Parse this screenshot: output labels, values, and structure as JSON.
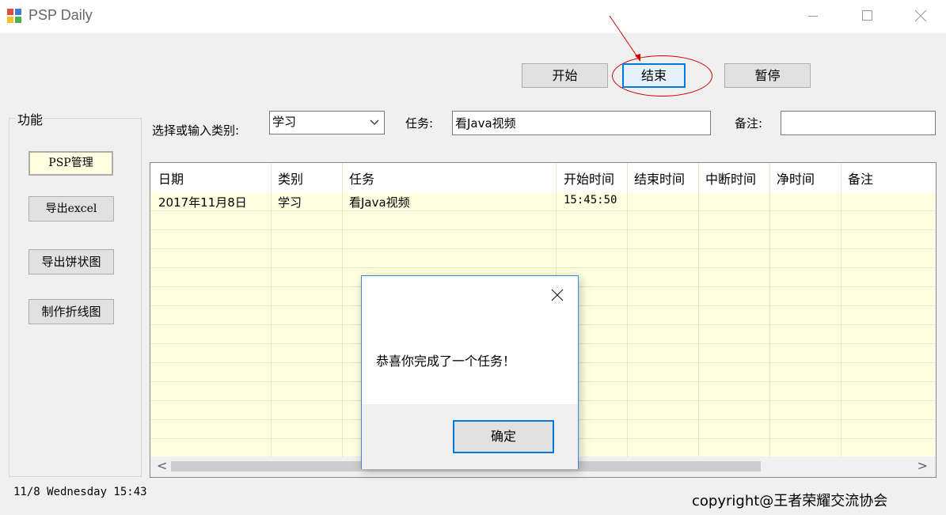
{
  "window": {
    "title": "PSP Daily",
    "icon": "app-icon",
    "controls": [
      "minimize-icon",
      "maximize-icon",
      "close-icon"
    ]
  },
  "toolbar": {
    "start_label": "开始",
    "end_label": "结束",
    "pause_label": "暂停"
  },
  "sidebar": {
    "group_title": "功能",
    "items": [
      {
        "label": "PSP管理"
      },
      {
        "label": "导出excel"
      },
      {
        "label": "导出饼状图"
      },
      {
        "label": "制作折线图"
      }
    ]
  },
  "form": {
    "category_label": "选择或输入类别:",
    "category_value": "学习",
    "task_label": "任务:",
    "task_value": "看Java视频",
    "note_label": "备注:",
    "note_value": ""
  },
  "grid": {
    "columns": [
      "日期",
      "类别",
      "任务",
      "开始时间",
      "结束时间",
      "中断时间",
      "净时间",
      "备注"
    ],
    "rows": [
      [
        "2017年11月8日",
        "学习",
        "看Java视频",
        "15:45:50",
        "",
        "",
        "",
        ""
      ]
    ],
    "scroll_left": "<",
    "scroll_right": ">"
  },
  "dialog": {
    "message": "恭喜你完成了一个任务！",
    "ok_label": "确定"
  },
  "status": {
    "datetime": "11/8  Wednesday 15:43"
  },
  "footer": {
    "copyright": "copyright@王者荣耀交流协会"
  },
  "colors": {
    "grid_background": "#ffffe1",
    "focus_border": "#0078d7",
    "annotation": "#d40000"
  }
}
